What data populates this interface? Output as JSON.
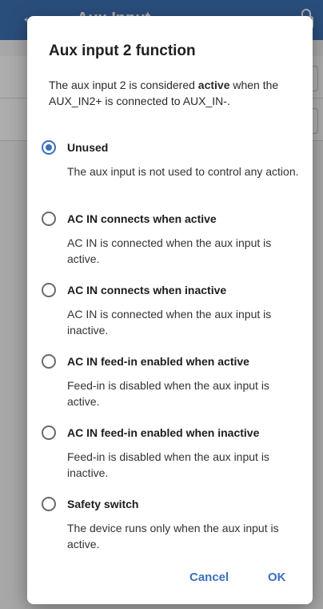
{
  "app": {
    "title": "Aux Input",
    "colors": {
      "bar": "#3f73b5"
    }
  },
  "dialog": {
    "title": "Aux input 2 function",
    "description_pre": "The aux input 2 is considered ",
    "description_bold": "active",
    "description_post": " when the AUX_IN2+ is connected to AUX_IN-.",
    "options": [
      {
        "label": "Unused",
        "description": "The aux input is not used to control any action.",
        "selected": true
      },
      {
        "label": "AC IN connects when active",
        "description": "AC IN is connected when the aux input is active.",
        "selected": false
      },
      {
        "label": "AC IN connects when inactive",
        "description": "AC IN is connected when the aux input is inactive.",
        "selected": false
      },
      {
        "label": "AC IN feed-in enabled when active",
        "description": "Feed-in is disabled when the aux input is active.",
        "selected": false
      },
      {
        "label": "AC IN feed-in enabled when inactive",
        "description": "Feed-in is disabled when the aux input is inactive.",
        "selected": false
      },
      {
        "label": "Safety switch",
        "description": "The device runs only when the aux input is active.",
        "selected": false
      }
    ],
    "cancel_label": "Cancel",
    "ok_label": "OK",
    "accent_color": "#3a6fbc"
  }
}
